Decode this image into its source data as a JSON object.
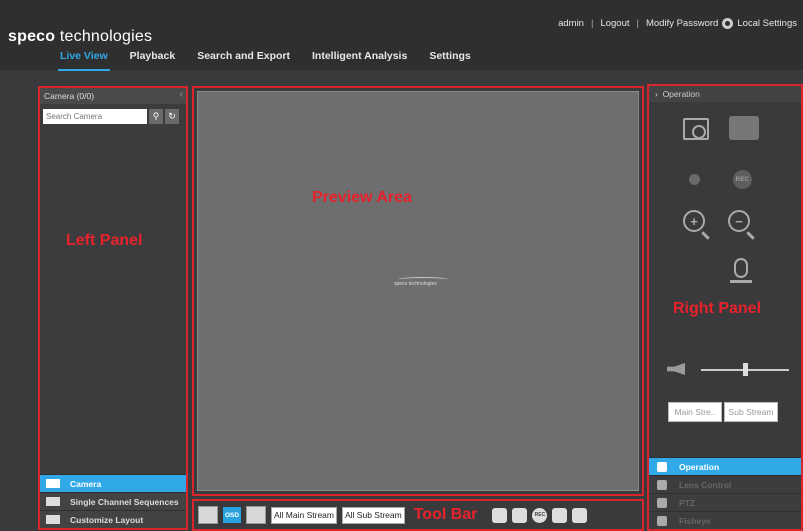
{
  "brand": {
    "name_bold": "speco",
    "name_light": " technologies"
  },
  "user": {
    "name": "admin",
    "logout": "Logout",
    "modify_password": "Modify Password",
    "local_settings": "Local Settings"
  },
  "nav": [
    {
      "label": "Live View",
      "active": true
    },
    {
      "label": "Playback"
    },
    {
      "label": "Search and Export"
    },
    {
      "label": "Intelligent Analysis"
    },
    {
      "label": "Settings"
    }
  ],
  "left_panel": {
    "title": "Camera (0/0)",
    "search_placeholder": "Search Camera",
    "overlay_label": "Left Panel",
    "menu": [
      {
        "label": "Camera",
        "active": true
      },
      {
        "label": "Single Channel Sequences"
      },
      {
        "label": "Customize Layout"
      }
    ]
  },
  "preview": {
    "overlay_label": "Preview Area",
    "watermark": "speco technologies"
  },
  "toolbar": {
    "overlay_label": "Tool Bar",
    "osd_label": "OSD",
    "all_main_stream": "All Main Stream",
    "all_sub_stream": "All Sub Stream",
    "rec_label": "REC"
  },
  "right_panel": {
    "title": "Operation",
    "overlay_label": "Right Panel",
    "rec_label": "REC",
    "zoom_in": "+",
    "zoom_out": "−",
    "main_stream": "Main Stre..",
    "sub_stream": "Sub Stream",
    "menu": [
      {
        "label": "Operation",
        "active": true
      },
      {
        "label": "Lens Control"
      },
      {
        "label": "PTZ"
      },
      {
        "label": "Fisheye"
      }
    ]
  },
  "colors": {
    "accent": "#31a9e8",
    "annotation_red": "#e8222a"
  }
}
